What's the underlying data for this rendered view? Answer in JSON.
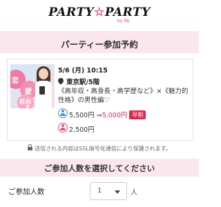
{
  "header": {
    "logo_left": "PARTY",
    "logo_star": "☆",
    "logo_right": "PARTY",
    "logo_sub": "by IBJ"
  },
  "reservation": {
    "title": "パーティー参加予約"
  },
  "party": {
    "thumbnail_chars": [
      "恋",
      "愛",
      "前",
      "向",
      "き"
    ],
    "date": "5/6 (月) 10:15",
    "place": "東京駅/5階",
    "title": "《高年収・高身長・高学歴など》×《魅力的性格》の男性編♡",
    "male_price_original": "5,500円",
    "male_price_arrow": " ⇒",
    "male_price_discount": "5,000円",
    "early_badge": "早割",
    "female_price": "2,500円"
  },
  "ssl_notice": "送信される内容はSSL暗号化通信により保護されます。",
  "participants": {
    "section_title": "ご参加人数を選択してください",
    "label": "ご参加人数",
    "selected": "1",
    "unit": "人"
  },
  "colors": {
    "accent": "#e84d7f",
    "band": "#fbe6ee",
    "discount": "#e0284f",
    "male": "#4a90d9"
  }
}
